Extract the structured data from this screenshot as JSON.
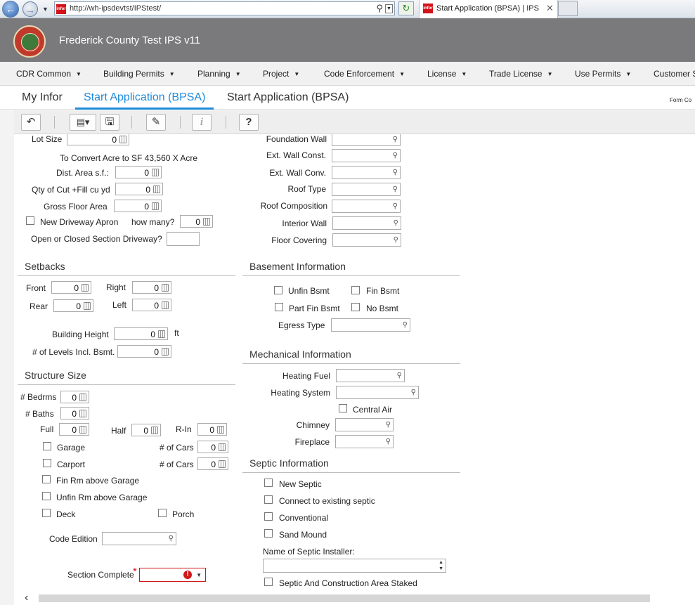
{
  "browser": {
    "url": "http://wh-ipsdevtst/IPStest/",
    "favicon_text": "infor",
    "tab_title": "Start Application (BPSA) | IPS"
  },
  "app": {
    "title": "Frederick County Test IPS v11",
    "menu": [
      "CDR Common",
      "Building Permits",
      "Planning",
      "Project",
      "Code Enforcement",
      "License",
      "Trade License",
      "Use Permits",
      "Customer S"
    ],
    "tabs": [
      "My Infor",
      "Start Application (BPSA)",
      "Start Application (BPSA)"
    ],
    "form_code": "Form Co",
    "accent": "#1f8ad8"
  },
  "toolbar": [
    "undo-icon",
    "map-icon",
    "save-icon",
    "eraser-icon",
    "info-icon",
    "help-icon"
  ],
  "left": {
    "lot_size": {
      "label": "Lot Size",
      "value": "0"
    },
    "convert_note": "To Convert Acre to SF 43,560 X Acre",
    "dist_area": {
      "label": "Dist. Area s.f.:",
      "value": "0"
    },
    "qty_cut": {
      "label": "Qty of Cut +Fill cu yd",
      "value": "0"
    },
    "gross_floor": {
      "label": "Gross Floor Area",
      "value": "0"
    },
    "new_driveway": "New Driveway Apron",
    "how_many": {
      "label": "how many?",
      "value": "0"
    },
    "driveway_q": "Open or Closed Section Driveway?",
    "setbacks": {
      "title": "Setbacks",
      "front": {
        "label": "Front",
        "value": "0"
      },
      "right": {
        "label": "Right",
        "value": "0"
      },
      "rear": {
        "label": "Rear",
        "value": "0"
      },
      "left": {
        "label": "Left",
        "value": "0"
      },
      "building_height": {
        "label": "Building Height",
        "value": "0",
        "unit": "ft"
      },
      "levels": {
        "label": "# of Levels Incl. Bsmt.",
        "value": "0"
      }
    },
    "structure": {
      "title": "Structure Size",
      "bedrms": {
        "label": "# Bedrms",
        "value": "0"
      },
      "baths": {
        "label": "# Baths",
        "value": "0"
      },
      "full": {
        "label": "Full",
        "value": "0"
      },
      "half": {
        "label": "Half",
        "value": "0"
      },
      "rin": {
        "label": "R-In",
        "value": "0"
      },
      "garage": "Garage",
      "garage_cars": {
        "label": "# of Cars",
        "value": "0"
      },
      "carport": "Carport",
      "carport_cars": {
        "label": "# of Cars",
        "value": "0"
      },
      "fin_rm": "Fin Rm above Garage",
      "unfin_rm": "Unfin Rm above Garage",
      "deck": "Deck",
      "porch": "Porch",
      "code_edition": "Code Edition",
      "section_complete": "Section Complete"
    }
  },
  "right": {
    "foundation_wall": "Foundation Wall",
    "ext_wall_const": "Ext. Wall Const.",
    "ext_wall_conv": "Ext. Wall Conv.",
    "roof_type": "Roof Type",
    "roof_comp": "Roof Composition",
    "interior_wall": "Interior Wall",
    "floor_covering": "Floor Covering",
    "basement": {
      "title": "Basement Information",
      "unfin": "Unfin Bsmt",
      "fin": "Fin Bsmt",
      "part_fin": "Part Fin Bsmt",
      "no": "No Bsmt",
      "egress": "Egress Type"
    },
    "mechanical": {
      "title": "Mechanical Information",
      "heating_fuel": "Heating Fuel",
      "heating_system": "Heating System",
      "central_air": "Central Air",
      "chimney": "Chimney",
      "fireplace": "Fireplace"
    },
    "septic": {
      "title": "Septic Information",
      "new": "New Septic",
      "connect": "Connect to existing septic",
      "conventional": "Conventional",
      "sand": "Sand Mound",
      "installer": "Name of Septic Installer:",
      "staked": "Septic And Construction Area Staked"
    }
  }
}
